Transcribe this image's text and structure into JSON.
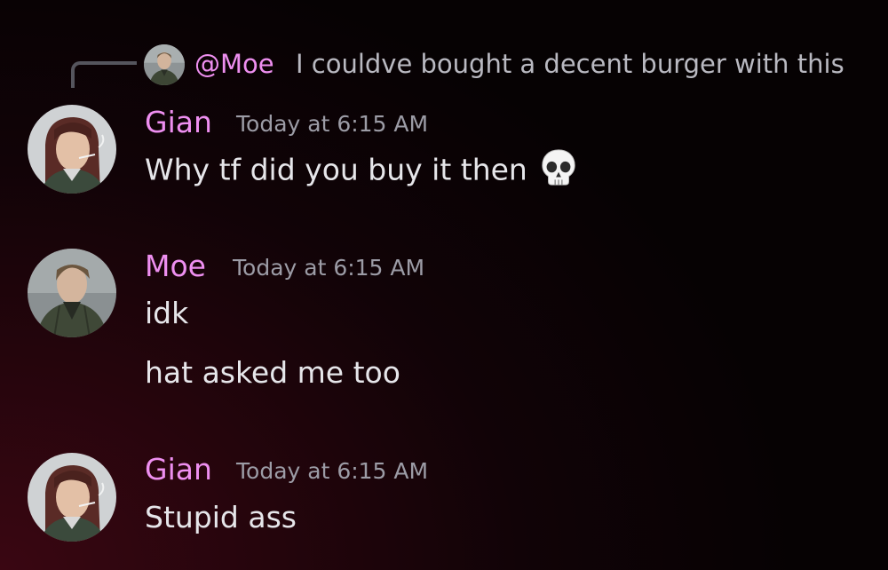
{
  "reply": {
    "mention": "@Moe",
    "text": "I couldve bought a decent burger with this"
  },
  "messages": [
    {
      "author": "Gian",
      "timestamp": "Today at 6:15 AM",
      "lines": [
        "Why tf did you buy it then"
      ],
      "emoji": "skull-emoji"
    },
    {
      "author": "Moe",
      "timestamp": "Today at 6:15 AM",
      "lines": [
        "idk",
        "hat asked me too"
      ]
    },
    {
      "author": "Gian",
      "timestamp": "Today at 6:15 AM",
      "lines": [
        "Stupid ass"
      ]
    }
  ],
  "colors": {
    "username": "#ee8ff0",
    "timestamp": "#9c9ca6",
    "message_text": "#e6e6ea",
    "background_dark": "#060203",
    "background_red": "#3a0612"
  }
}
